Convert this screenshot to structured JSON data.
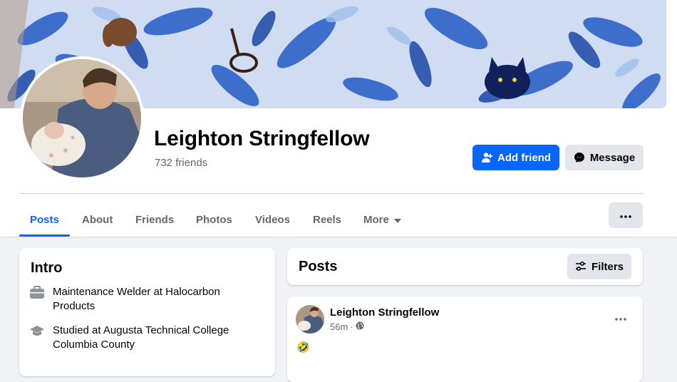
{
  "profile": {
    "name": "Leighton Stringfellow",
    "friends_count": "732 friends"
  },
  "actions": {
    "add_friend_label": "Add friend",
    "message_label": "Message"
  },
  "tabs": [
    {
      "label": "Posts",
      "active": true
    },
    {
      "label": "About"
    },
    {
      "label": "Friends"
    },
    {
      "label": "Photos"
    },
    {
      "label": "Videos"
    },
    {
      "label": "Reels"
    },
    {
      "label": "More",
      "icon": "caret-down-icon"
    }
  ],
  "intro": {
    "title": "Intro",
    "items": [
      {
        "icon": "briefcase-icon",
        "text": "Maintenance Welder at Halocarbon Products"
      },
      {
        "icon": "graduation-cap-icon",
        "text": "Studied at Augusta Technical College Columbia County"
      }
    ]
  },
  "posts_section": {
    "title": "Posts",
    "filters_label": "Filters"
  },
  "post": {
    "author": "Leighton Stringfellow",
    "time": "56m",
    "separator": "·",
    "audience_icon": "globe-icon",
    "content": "🤣"
  },
  "colors": {
    "accent": "#0866ff",
    "secondary_button": "#e4e6eb",
    "page_background": "#f0f2f5",
    "muted_text": "#65676b"
  }
}
